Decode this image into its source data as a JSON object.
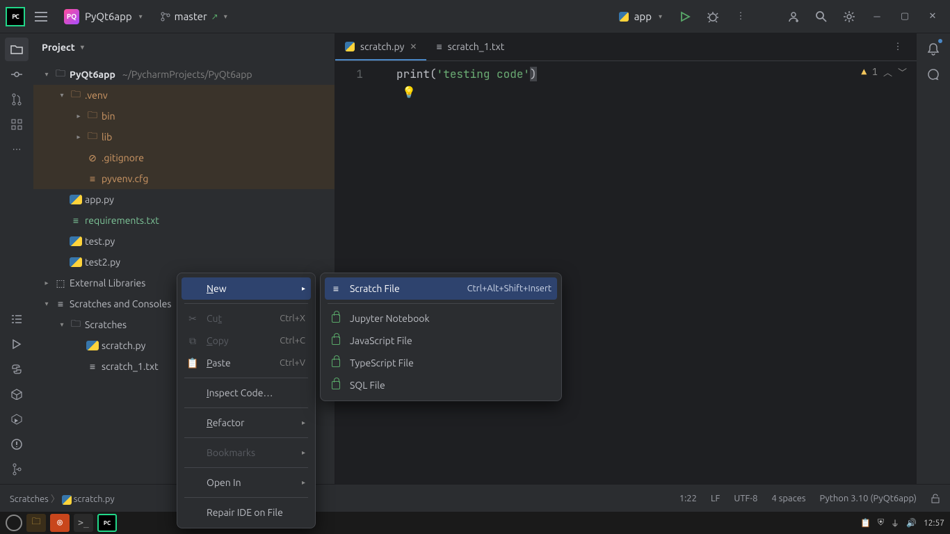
{
  "titlebar": {
    "project": "PyQt6app",
    "branch": "master",
    "runconfig": "app"
  },
  "sidebar": {
    "title": "Project",
    "root": "PyQt6app",
    "root_path": "~/PycharmProjects/PyQt6app",
    "venv": ".venv",
    "bin": "bin",
    "lib": "lib",
    "gitignore": ".gitignore",
    "pyvenv": "pyvenv.cfg",
    "app_py": "app.py",
    "req": "requirements.txt",
    "test_py": "test.py",
    "test2_py": "test2.py",
    "ext_lib": "External Libraries",
    "scratches_root": "Scratches and Consoles",
    "scratches": "Scratches",
    "scratch_py": "scratch.py",
    "scratch_txt": "scratch_1.txt"
  },
  "tabs": {
    "t1": "scratch.py",
    "t2": "scratch_1.txt"
  },
  "code": {
    "line_no": "1",
    "fn": "print",
    "paren_open": "(",
    "str": "'testing code'",
    "paren_close": ")"
  },
  "inspect": {
    "warn_count": "1"
  },
  "ctx1": {
    "new": "New",
    "cut": "Cut",
    "cut_sc": "Ctrl+X",
    "copy": "Copy",
    "copy_sc": "Ctrl+C",
    "paste": "Paste",
    "paste_sc": "Ctrl+V",
    "inspect": "Inspect Code…",
    "refactor": "Refactor",
    "bookmarks": "Bookmarks",
    "openin": "Open In",
    "repair": "Repair IDE on File"
  },
  "ctx2": {
    "scratch": "Scratch File",
    "scratch_sc": "Ctrl+Alt+Shift+Insert",
    "jupyter": "Jupyter Notebook",
    "js": "JavaScript File",
    "ts": "TypeScript File",
    "sql": "SQL File"
  },
  "status": {
    "crumbs1": "Scratches",
    "crumbs2": "scratch.py",
    "pos": "1:22",
    "lf": "LF",
    "enc": "UTF-8",
    "indent": "4 spaces",
    "interp": "Python 3.10 (PyQt6app)"
  },
  "tray": {
    "time": "12:57"
  }
}
